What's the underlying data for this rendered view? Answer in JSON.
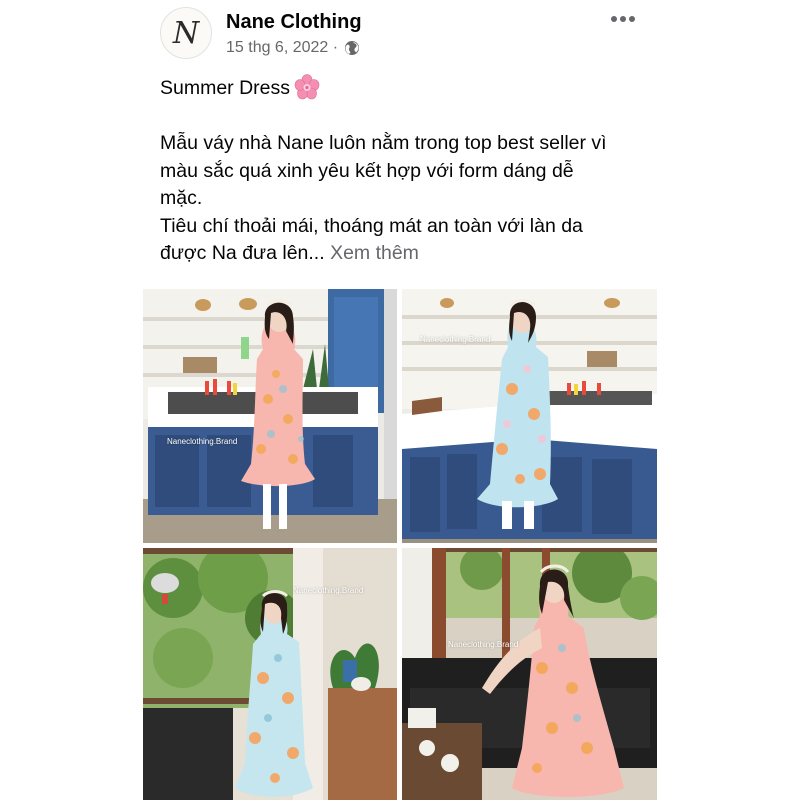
{
  "post": {
    "page_name": "Nane Clothing",
    "avatar_letter": "N",
    "date": "15 thg 6, 2022 ·",
    "privacy_icon": "globe-icon",
    "more_icon": "more-horizontal-icon",
    "title": "Summer Dress",
    "title_emoji": "cherry-blossom-icon",
    "body_line_1": "Mẫu váy nhà Nane luôn nằm trong top best seller vì",
    "body_line_2": "màu sắc quá xinh yêu kết hợp với form dáng dễ",
    "body_line_3": "mặc.",
    "body_line_4": "Tiêu chí thoải mái, thoáng mát an toàn với làn da",
    "body_line_5": "được Na đưa lên...",
    "see_more": "Xem thêm"
  },
  "photos": [
    {
      "watermark": "Naneclothing.Brand",
      "subject": "model in pink floral dress in kitchen"
    },
    {
      "watermark": "Naneclothing.Brand",
      "subject": "model in blue floral dress in kitchen"
    },
    {
      "watermark": "Naneclothing.Brand",
      "subject": "model in blue floral dress by window"
    },
    {
      "watermark": "Naneclothing.Brand",
      "subject": "model in pink floral dress on sofa"
    }
  ],
  "colors": {
    "text": "#050505",
    "secondary_text": "#65676b",
    "cabinet_blue": "#34558c",
    "dress_pink": "#f7b7ae",
    "dress_blue": "#bfe3ef"
  }
}
